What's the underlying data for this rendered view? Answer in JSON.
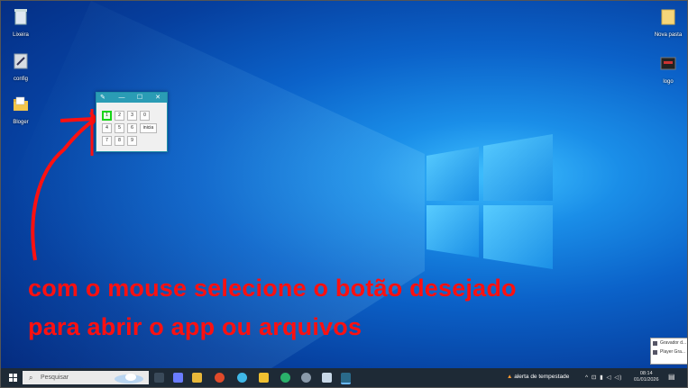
{
  "desktop": {
    "icons_left": [
      {
        "label": "Lixeira",
        "icon": "recycle-bin-icon"
      },
      {
        "label": "config",
        "icon": "settings-shortcut-icon"
      },
      {
        "label": "Bloger",
        "icon": "folder-icon"
      }
    ],
    "icons_right": [
      {
        "label": "Nova pasta",
        "icon": "folder-icon"
      },
      {
        "label": "logo",
        "icon": "image-icon"
      }
    ]
  },
  "app_window": {
    "title_controls": {
      "minimize": "—",
      "maximize": "☐",
      "close": "✕"
    },
    "buttons_row1": [
      "1",
      "2",
      "3",
      "0"
    ],
    "buttons_row2": [
      "4",
      "5",
      "6",
      "inicia"
    ],
    "buttons_row3": [
      "7",
      "8",
      "9"
    ]
  },
  "caption": {
    "line1": "com o mouse selecione o botão desejado",
    "line2": "para abrir o app ou arquivos"
  },
  "taskbar": {
    "search_placeholder": "Pesquisar",
    "weather": "alerta de tempestade",
    "tray": "^ ⊡ ▮ ◁ ◁)",
    "time": "08:14",
    "date": "01/01/2026"
  },
  "popup": {
    "items": [
      "Gravador d...",
      "Player Gra..."
    ]
  },
  "colors": {
    "caption": "#ff1010",
    "selected_border": "#18d418",
    "taskbar": "#1e2a36"
  }
}
